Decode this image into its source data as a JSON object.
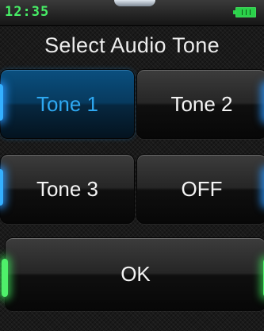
{
  "status_bar": {
    "time": "12:35",
    "battery_icon": "battery-full-icon"
  },
  "title": "Select Audio Tone",
  "options": [
    {
      "label": "Tone 1",
      "selected": true
    },
    {
      "label": "Tone 2",
      "selected": false
    },
    {
      "label": "Tone 3",
      "selected": false
    },
    {
      "label": "OFF",
      "selected": false
    }
  ],
  "ok_label": "OK",
  "colors": {
    "clock": "#47ee66",
    "battery": "#2bd14a",
    "selected_text": "#2ea8f1",
    "blue_glow": "#34b0ff",
    "green_glow": "#4ff06a"
  }
}
